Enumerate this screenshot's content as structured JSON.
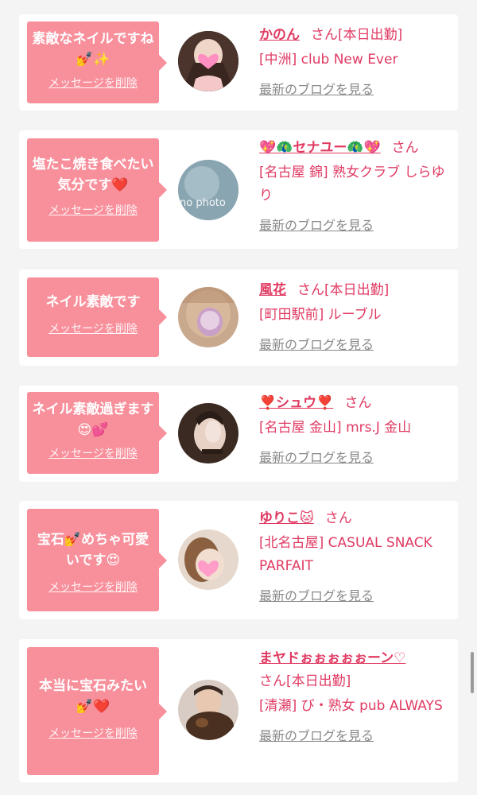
{
  "items": [
    {
      "message": "素敵なネイルですね💅✨",
      "delete_label": "メッセージを削除",
      "name": "かのん",
      "san": "さん",
      "status": "[本日出勤]",
      "shop": "[中洲] club New Ever",
      "blog_label": "最新のブログを見る"
    },
    {
      "message": "塩たこ焼き食べたい気分です❤️",
      "delete_label": "メッセージを削除",
      "name": "💖🦚セナユー🦚💖",
      "san": "さん",
      "status": "",
      "shop": "[名古屋 錦] 熟女クラブ しらゆり",
      "avatar_text": "no photo",
      "blog_label": "最新のブログを見る"
    },
    {
      "message": "ネイル素敵です",
      "delete_label": "メッセージを削除",
      "name": "風花",
      "san": "さん",
      "status": "[本日出勤]",
      "shop": "[町田駅前] ルーブル",
      "blog_label": "最新のブログを見る"
    },
    {
      "message": "ネイル素敵過ぎます😍💕",
      "delete_label": "メッセージを削除",
      "name": "❣️シュウ❣️",
      "san": "さん",
      "status": "",
      "shop": "[名古屋 金山] mrs.J 金山",
      "blog_label": "最新のブログを見る"
    },
    {
      "message": "宝石💅めちゃ可愛いです😍",
      "delete_label": "メッセージを削除",
      "name": "ゆりこ🐱",
      "san": "さん",
      "status": "",
      "shop": "[北名古屋] CASUAL SNACK PARFAIT",
      "blog_label": "最新のブログを見る"
    },
    {
      "message": "本当に宝石みたい💅❤️",
      "delete_label": "メッセージを削除",
      "name": "まヤドぉぉぉぉぉーン♡",
      "san": "さん",
      "status": "[本日出勤]",
      "shop": "[清瀬] び・熟女 pub ALWAYS",
      "blog_label": "最新のブログを見る"
    }
  ],
  "colors": {
    "accent": "#e03a62",
    "bubble": "#f8909c",
    "background": "#f4f4f4",
    "link_gray": "#888888"
  },
  "icons": [
    "heart-sticker-icon"
  ]
}
